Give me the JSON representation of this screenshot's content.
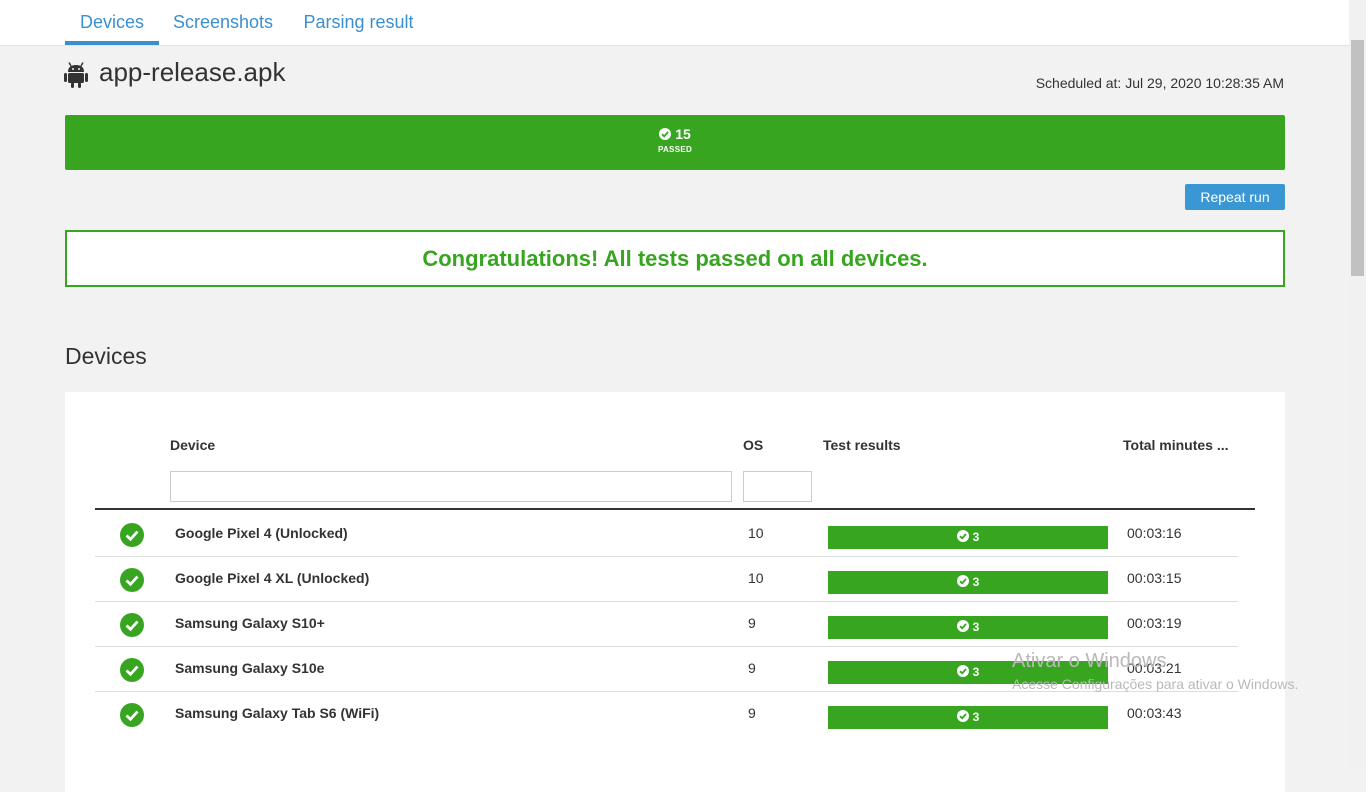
{
  "tabs": [
    {
      "label": "Devices",
      "active": true
    },
    {
      "label": "Screenshots",
      "active": false
    },
    {
      "label": "Parsing result",
      "active": false
    }
  ],
  "header": {
    "app_name": "app-release.apk",
    "app_icon": "android-icon",
    "scheduled": "Scheduled at: Jul 29, 2020 10:28:35 AM"
  },
  "summary": {
    "passed_count": "15",
    "passed_label": "PASSED",
    "color": "#37a520"
  },
  "actions": {
    "repeat_run": "Repeat run"
  },
  "banner": {
    "message": "Congratulations! All tests passed on all devices."
  },
  "devices_section": {
    "title": "Devices",
    "columns": {
      "device": "Device",
      "os": "OS",
      "results": "Test results",
      "minutes": "Total minutes ..."
    },
    "filters": {
      "device": "",
      "os": ""
    },
    "rows": [
      {
        "status": "passed",
        "device": "Google Pixel 4 (Unlocked)",
        "os": "10",
        "passed": "3",
        "minutes": "00:03:16"
      },
      {
        "status": "passed",
        "device": "Google Pixel 4 XL (Unlocked)",
        "os": "10",
        "passed": "3",
        "minutes": "00:03:15"
      },
      {
        "status": "passed",
        "device": "Samsung Galaxy S10+",
        "os": "9",
        "passed": "3",
        "minutes": "00:03:19"
      },
      {
        "status": "passed",
        "device": "Samsung Galaxy S10e",
        "os": "9",
        "passed": "3",
        "minutes": "00:03:21"
      },
      {
        "status": "passed",
        "device": "Samsung Galaxy Tab S6 (WiFi)",
        "os": "9",
        "passed": "3",
        "minutes": "00:03:43"
      }
    ]
  },
  "watermark": {
    "line1": "Ativar o Windows",
    "line2": "Acesse Configurações para ativar o Windows."
  },
  "colors": {
    "accent": "#3a8fd0",
    "success": "#37a520",
    "button": "#3a97d4"
  }
}
